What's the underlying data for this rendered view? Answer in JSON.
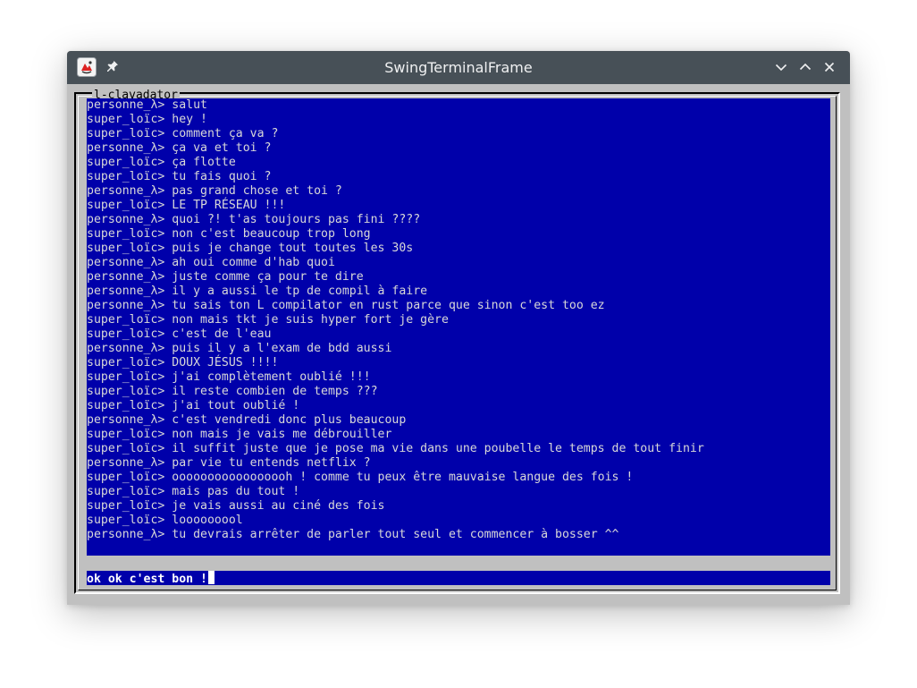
{
  "window": {
    "title": "SwingTerminalFrame"
  },
  "panel": {
    "label": "l-clavadator"
  },
  "chat": {
    "lines": [
      {
        "user": "personne_λ",
        "text": "salut"
      },
      {
        "user": "super_loïc",
        "text": "hey !"
      },
      {
        "user": "super_loïc",
        "text": "comment ça va ?"
      },
      {
        "user": "personne_λ",
        "text": "ça va et toi ?"
      },
      {
        "user": "super_loïc",
        "text": "ça flotte"
      },
      {
        "user": "super_loïc",
        "text": "tu fais quoi ?"
      },
      {
        "user": "personne_λ",
        "text": "pas grand chose et toi ?"
      },
      {
        "user": "super_loïc",
        "text": "LE TP RÉSEAU !!!"
      },
      {
        "user": "personne_λ",
        "text": "quoi ?! t'as toujours pas fini ????"
      },
      {
        "user": "super_loïc",
        "text": "non c'est beaucoup trop long"
      },
      {
        "user": "super_loïc",
        "text": "puis je change tout toutes les 30s"
      },
      {
        "user": "personne_λ",
        "text": "ah oui comme d'hab quoi"
      },
      {
        "user": "personne_λ",
        "text": "juste comme ça pour te dire"
      },
      {
        "user": "personne_λ",
        "text": "il y a aussi le tp de compil à faire"
      },
      {
        "user": "personne_λ",
        "text": "tu sais ton L compilator en rust parce que sinon c'est too ez"
      },
      {
        "user": "super_loïc",
        "text": "non mais tkt je suis hyper fort je gère"
      },
      {
        "user": "super_loïc",
        "text": "c'est de l'eau"
      },
      {
        "user": "personne_λ",
        "text": "puis il y a l'exam de bdd aussi"
      },
      {
        "user": "super_loïc",
        "text": "DOUX JÉSUS !!!!"
      },
      {
        "user": "super_loïc",
        "text": "j'ai complètement oublié !!!"
      },
      {
        "user": "super_loïc",
        "text": "il reste combien de temps ???"
      },
      {
        "user": "super_loïc",
        "text": "j'ai tout oublié !"
      },
      {
        "user": "personne_λ",
        "text": "c'est vendredi donc plus beaucoup"
      },
      {
        "user": "super_loïc",
        "text": "non mais je vais me débrouiller"
      },
      {
        "user": "super_loïc",
        "text": "il suffit juste que je pose ma vie dans une poubelle le temps de tout finir"
      },
      {
        "user": "personne_λ",
        "text": "par vie tu entends netflix ?"
      },
      {
        "user": "super_loïc",
        "text": "ooooooooooooooooh ! comme tu peux être mauvaise langue des fois !"
      },
      {
        "user": "super_loïc",
        "text": "mais pas du tout !"
      },
      {
        "user": "super_loïc",
        "text": "je vais aussi au ciné des fois"
      },
      {
        "user": "super_loïc",
        "text": "looooooool"
      },
      {
        "user": "personne_λ",
        "text": "tu devrais arrêter de parler tout seul et commencer à bosser ^^"
      }
    ]
  },
  "input": {
    "value": "ok ok c'est bon !"
  },
  "colors": {
    "titlebar": "#475057",
    "terminal_bg": "#0000aa",
    "terminal_fg": "#d8d8d8",
    "panel_bg": "#c0c0c0"
  },
  "icons": {
    "app": "java-app-icon",
    "pin": "pin-icon",
    "minimize": "chevron-down-icon",
    "maximize": "chevron-up-icon",
    "close": "close-icon"
  }
}
